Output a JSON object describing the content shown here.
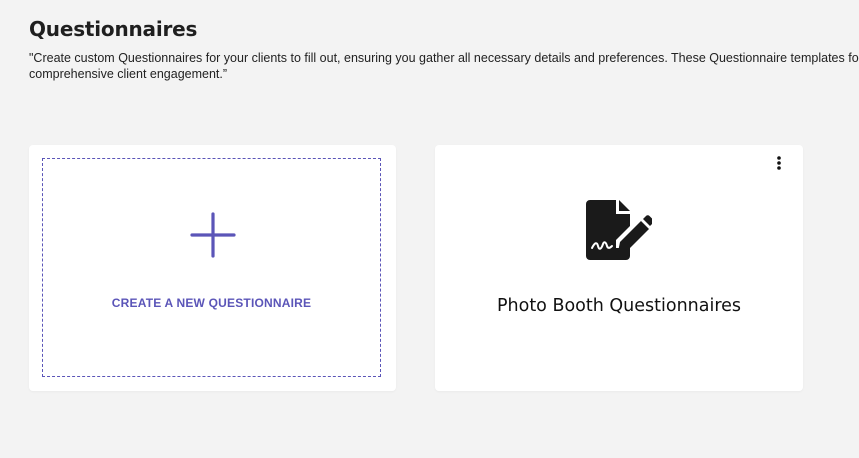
{
  "header": {
    "title": "Questionnaires",
    "description": "\"Create custom Questionnaires for your clients to fill out, ensuring you gather all necessary details and preferences. These Questionnaire templates for comprehensive client engagement.”"
  },
  "cards": {
    "create": {
      "label": "CREATE A NEW QUESTIONNAIRE",
      "icon": "plus-icon"
    },
    "items": [
      {
        "title": "Photo Booth Questionnaires",
        "icon": "file-signature-icon",
        "menu_icon": "kebab-menu-icon"
      }
    ]
  },
  "colors": {
    "accent": "#5b55b8",
    "background": "#f3f3f3",
    "card": "#ffffff",
    "text": "#1f1f1f"
  }
}
